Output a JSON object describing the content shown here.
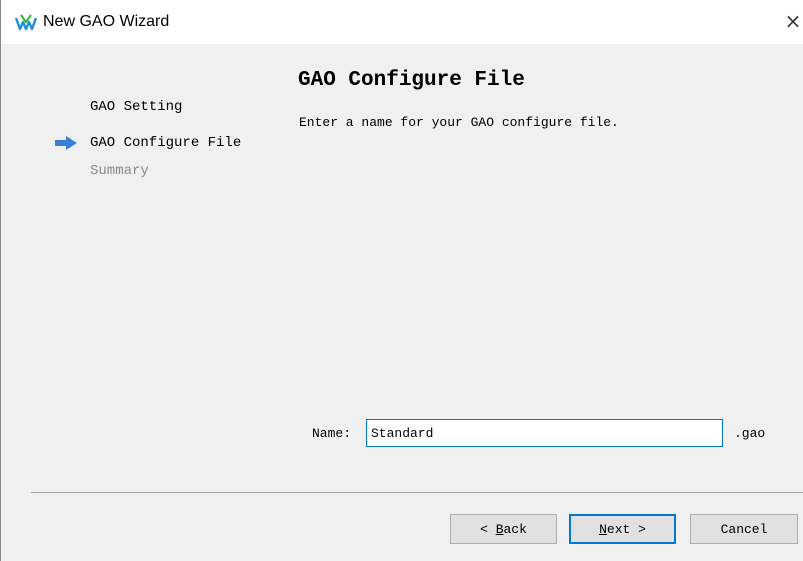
{
  "window": {
    "title": "New GAO Wizard",
    "close_symbol": "×",
    "app_icon": "gowin-logo-icon"
  },
  "steps": [
    {
      "label": "GAO Setting",
      "state": "completed"
    },
    {
      "label": "GAO Configure File",
      "state": "current"
    },
    {
      "label": "Summary",
      "state": "pending"
    }
  ],
  "current_step_marker": "arrow-right-icon",
  "page": {
    "title": "GAO Configure File",
    "description": "Enter a name for your GAO configure file."
  },
  "form": {
    "name_label": "Name:",
    "name_value": "Standard",
    "extension": ".gao"
  },
  "buttons": {
    "back": {
      "prefix": "< ",
      "mnemonic": "B",
      "rest": "ack"
    },
    "next": {
      "mnemonic": "N",
      "rest": "ext >"
    },
    "cancel": {
      "label": "Cancel"
    }
  },
  "colors": {
    "accent": "#0078d7",
    "arrow": "#3a7fd6",
    "disabled_text": "#8a8a8a"
  }
}
